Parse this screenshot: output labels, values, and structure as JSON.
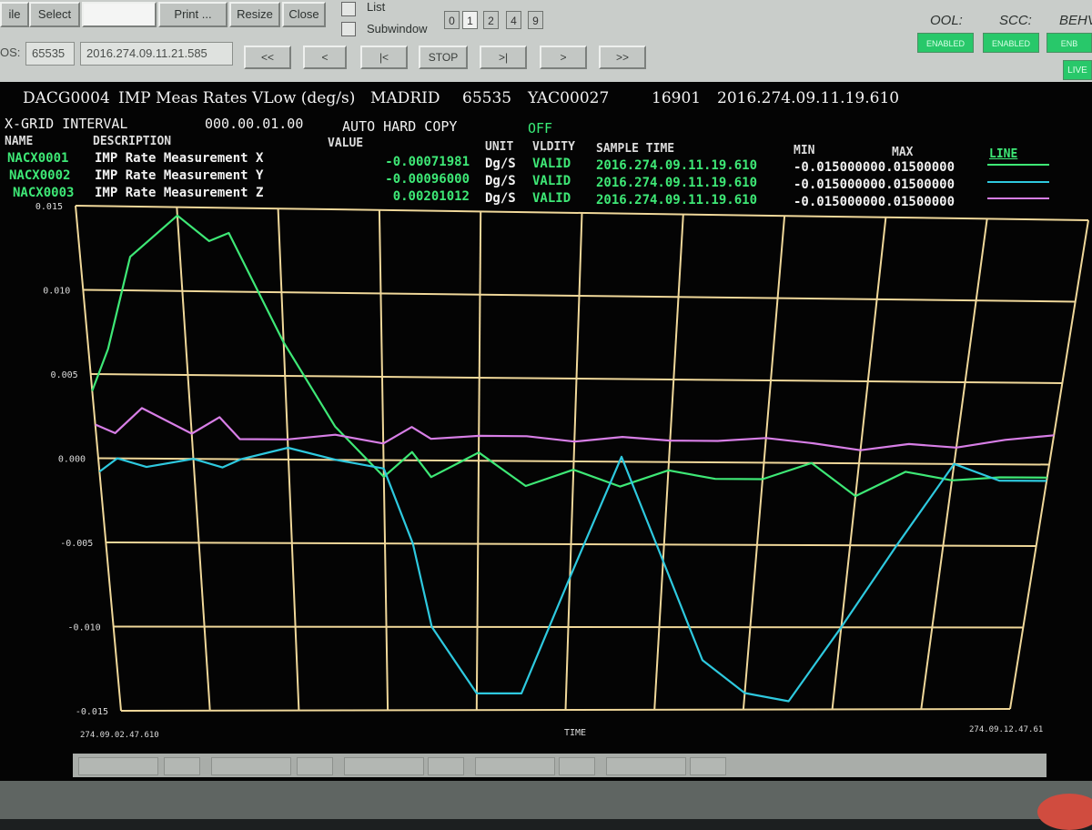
{
  "menu": [
    "ile",
    "Select",
    "",
    "Print ...",
    "Resize",
    "Close"
  ],
  "options": {
    "list": "List",
    "subwindow": "Subwindow",
    "pages": [
      "0",
      "1",
      "2",
      "4",
      "9"
    ]
  },
  "status": {
    "labels": [
      "OOL:",
      "SCC:",
      "BEHV"
    ],
    "buttons": [
      "ENABLED",
      "ENABLED",
      "ENB"
    ],
    "live": "LIVE"
  },
  "nav": {
    "os_label": "OS:",
    "id": "65535",
    "time": "2016.274.09.11.21.585",
    "buttons": [
      "<<",
      "<",
      "|<",
      "STOP",
      ">|",
      ">",
      ">>"
    ]
  },
  "display": {
    "name": "DACG0004",
    "title": "IMP Meas Rates VLow (deg/s)",
    "site": "MADRID",
    "id": "65535",
    "yac": "YAC00027",
    "num": "16901",
    "timestamp": "2016.274.09.11.19.610",
    "grid_label": "X-GRID INTERVAL",
    "grid_value": "000.00.01.00",
    "hardcopy_label": "AUTO HARD COPY",
    "hardcopy_value": "OFF"
  },
  "columns": [
    "NAME",
    "DESCRIPTION",
    "VALUE",
    "UNIT",
    "VLDITY",
    "SAMPLE TIME",
    "MIN",
    "MAX",
    "LINE"
  ],
  "params": [
    {
      "name": "NACX0001",
      "desc": "IMP Rate Measurement X",
      "value": "-0.00071981",
      "unit": "Dg/S",
      "validity": "VALID",
      "time": "2016.274.09.11.19.610",
      "minmax": "-0.015000000.01500000",
      "color": "#3ee876"
    },
    {
      "name": "NACX0002",
      "desc": "IMP Rate Measurement Y",
      "value": "-0.00096000",
      "unit": "Dg/S",
      "validity": "VALID",
      "time": "2016.274.09.11.19.610",
      "minmax": "-0.015000000.01500000",
      "color": "#2ec9df"
    },
    {
      "name": "NACX0003",
      "desc": "IMP Rate Measurement Z",
      "value": "0.00201012",
      "unit": "Dg/S",
      "validity": "VALID",
      "time": "2016.274.09.11.19.610",
      "minmax": "-0.015000000.01500000",
      "color": "#d77ee6"
    }
  ],
  "chart_data": {
    "type": "line",
    "xlabel": "TIME",
    "x_start_label": "274.09.02.47.610",
    "x_end_label": "274.09.12.47.61",
    "ylim": [
      -0.015,
      0.015
    ],
    "yticks": [
      "0.015",
      "0.010",
      "0.005",
      "0.000",
      "-0.005",
      "-0.010",
      "-0.015"
    ],
    "grid": true,
    "x": [
      0,
      0.2,
      0.5,
      1.0,
      1.3,
      1.5,
      2.0,
      2.5,
      3.0,
      3.3,
      3.5,
      4.0,
      4.5,
      5.0,
      5.5,
      6.0,
      6.5,
      7.0,
      7.5,
      8.0,
      8.5,
      9.0,
      9.5,
      10.0
    ],
    "series": [
      {
        "name": "NACX0001",
        "values": [
          0.004,
          0.0065,
          0.012,
          0.0145,
          0.013,
          0.0135,
          0.007,
          0.002,
          -0.001,
          0.0005,
          -0.001,
          0.0005,
          -0.0015,
          -0.0005,
          -0.0015,
          -0.0005,
          -0.001,
          -0.001,
          0.0,
          -0.002,
          -0.0005,
          -0.001,
          -0.0008,
          -0.0008
        ]
      },
      {
        "name": "NACX0002",
        "values": [
          -0.0008,
          0.0,
          -0.0005,
          0.0,
          -0.0005,
          0.0,
          0.0007,
          0.0,
          -0.0005,
          -0.005,
          -0.01,
          -0.014,
          -0.014,
          -0.007,
          0.0003,
          -0.006,
          -0.012,
          -0.014,
          -0.0145,
          -0.01,
          -0.005,
          0.0,
          -0.001,
          -0.001
        ]
      },
      {
        "name": "NACX0003",
        "values": [
          0.002,
          0.0015,
          0.003,
          0.0015,
          0.0025,
          0.0012,
          0.0012,
          0.0015,
          0.001,
          0.002,
          0.0013,
          0.0015,
          0.0015,
          0.0012,
          0.0015,
          0.0013,
          0.0013,
          0.0015,
          0.0012,
          0.0008,
          0.0012,
          0.001,
          0.0015,
          0.0018
        ]
      }
    ]
  }
}
